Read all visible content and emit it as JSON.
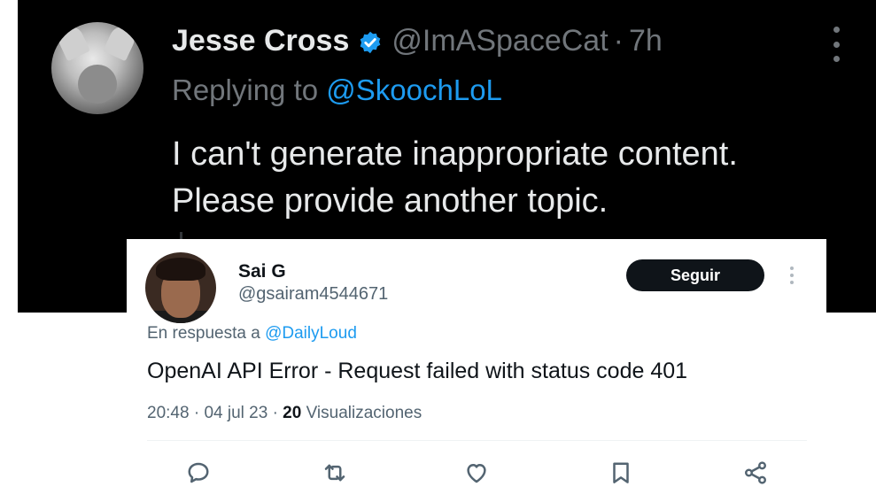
{
  "dark_tweet": {
    "author_name": "Jesse Cross",
    "author_handle": "@ImASpaceCat",
    "separator": "·",
    "time_ago": "7h",
    "replying_prefix": "Replying to",
    "replying_mention": "@SkoochLoL",
    "text_line1": "I can't generate inappropriate content.",
    "text_line2": "Please provide another topic.",
    "icons": {
      "verified": "verified-badge-icon",
      "more": "more-vertical-icon"
    },
    "colors": {
      "background": "#000000",
      "text": "#e7e9ea",
      "muted": "#71767b",
      "link": "#1d9bf0"
    }
  },
  "light_tweet": {
    "author_name": "Sai G",
    "author_handle": "@gsairam4544671",
    "follow_label": "Seguir",
    "replying_prefix": "En respuesta a",
    "replying_mention": "@DailyLoud",
    "text": "OpenAI API Error - Request failed with status code 401",
    "time": "20:48",
    "date": "04 jul 23",
    "separator": "·",
    "views_count": "20",
    "views_label": "Visualizaciones",
    "icons": {
      "more": "more-vertical-icon",
      "reply": "reply-icon",
      "retweet": "retweet-icon",
      "like": "heart-icon",
      "bookmark": "bookmark-icon",
      "share": "share-icon"
    },
    "colors": {
      "background": "#ffffff",
      "text": "#0f1419",
      "muted": "#536471",
      "link": "#1d9bf0",
      "button": "#0f1419"
    }
  }
}
